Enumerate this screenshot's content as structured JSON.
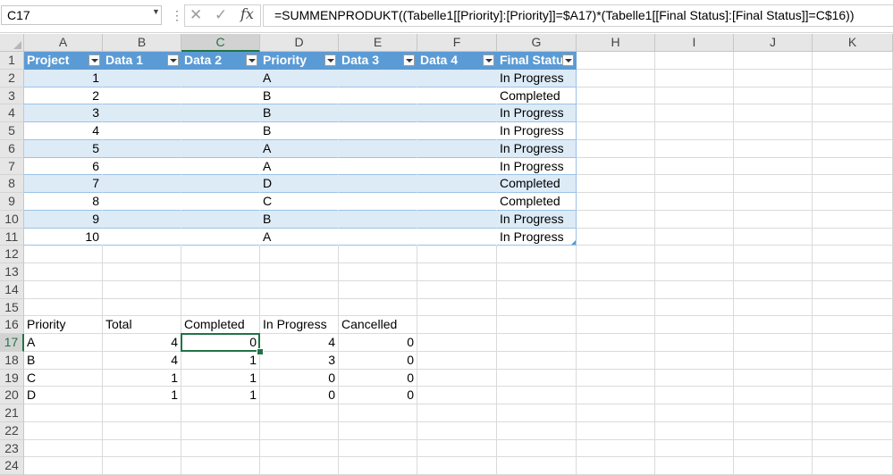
{
  "name_box": "C17",
  "formula": "=SUMMENPRODUKT((Tabelle1[[Priority]:[Priority]]=$A17)*(Tabelle1[[Final Status]:[Final Status]]=C$16))",
  "columns": [
    "A",
    "B",
    "C",
    "D",
    "E",
    "F",
    "G",
    "H",
    "I",
    "J",
    "K"
  ],
  "rows": [
    "1",
    "2",
    "3",
    "4",
    "5",
    "6",
    "7",
    "8",
    "9",
    "10",
    "11",
    "12",
    "13",
    "14",
    "15",
    "16",
    "17",
    "18",
    "19",
    "20",
    "21",
    "22",
    "23",
    "24"
  ],
  "selected_column": "C",
  "selected_row": "17",
  "table_headers": [
    "Project",
    "Data 1",
    "Data 2",
    "Priority",
    "Data 3",
    "Data 4",
    "Final Status"
  ],
  "table_rows": [
    [
      "1",
      "",
      "",
      "A",
      "",
      "",
      "In Progress"
    ],
    [
      "2",
      "",
      "",
      "B",
      "",
      "",
      "Completed"
    ],
    [
      "3",
      "",
      "",
      "B",
      "",
      "",
      "In Progress"
    ],
    [
      "4",
      "",
      "",
      "B",
      "",
      "",
      "In Progress"
    ],
    [
      "5",
      "",
      "",
      "A",
      "",
      "",
      "In Progress"
    ],
    [
      "6",
      "",
      "",
      "A",
      "",
      "",
      "In Progress"
    ],
    [
      "7",
      "",
      "",
      "D",
      "",
      "",
      "Completed"
    ],
    [
      "8",
      "",
      "",
      "C",
      "",
      "",
      "Completed"
    ],
    [
      "9",
      "",
      "",
      "B",
      "",
      "",
      "In Progress"
    ],
    [
      "10",
      "",
      "",
      "A",
      "",
      "",
      "In Progress"
    ]
  ],
  "summary_headers": [
    "Priority",
    "Total",
    "Completed",
    "In Progress",
    "Cancelled"
  ],
  "summary_rows": [
    [
      "A",
      "4",
      "0",
      "4",
      "0"
    ],
    [
      "B",
      "4",
      "1",
      "3",
      "0"
    ],
    [
      "C",
      "1",
      "1",
      "0",
      "0"
    ],
    [
      "D",
      "1",
      "1",
      "0",
      "0"
    ]
  ],
  "colors": {
    "table_header": "#5b9bd5",
    "band": "#ddebf7",
    "selection": "#217346"
  },
  "icons": {
    "cancel": "close-icon",
    "enter": "check-icon",
    "function": "fx-icon",
    "filter": "filter-dropdown-icon"
  }
}
